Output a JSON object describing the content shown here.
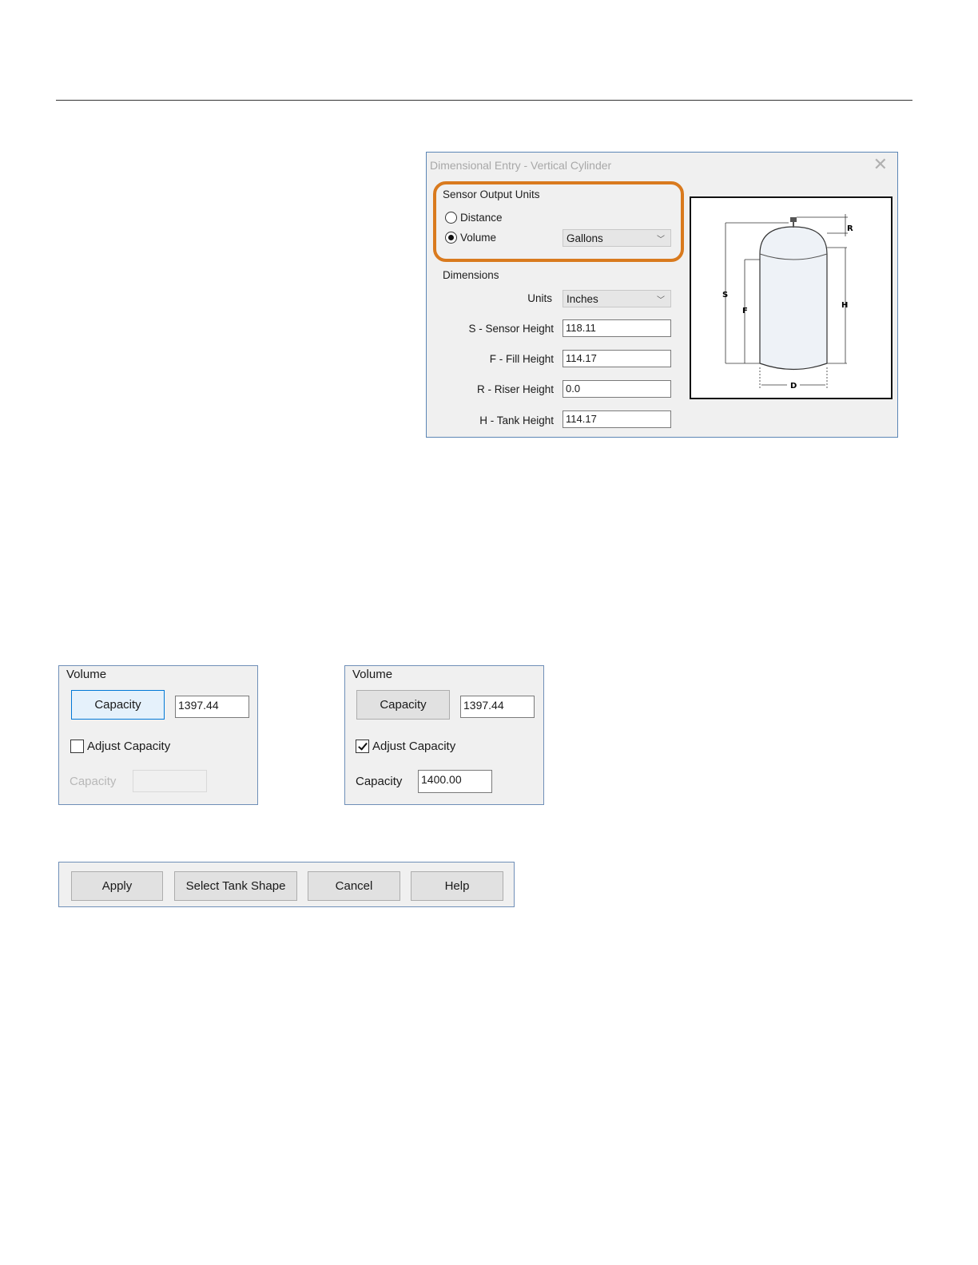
{
  "dialog": {
    "title": "Dimensional Entry - Vertical Cylinder",
    "close": "✕",
    "output_units": {
      "label": "Sensor Output Units",
      "distance_label": "Distance",
      "volume_label": "Volume",
      "selected": "Volume",
      "volume_unit": "Gallons"
    },
    "dimensions": {
      "label": "Dimensions",
      "units_label": "Units",
      "units_value": "Inches",
      "fields": [
        {
          "label": "S - Sensor Height",
          "value": "118.11"
        },
        {
          "label": "F - Fill Height",
          "value": "114.17"
        },
        {
          "label": "R - Riser Height",
          "value": "0.0"
        },
        {
          "label": "H - Tank Height",
          "value": "114.17"
        }
      ]
    },
    "diagram": {
      "s": "S",
      "f": "F",
      "h": "H",
      "r": "R",
      "d": "D"
    }
  },
  "volume_panel_left": {
    "title": "Volume",
    "capacity_button": "Capacity",
    "capacity_value": "1397.44",
    "adjust_label": "Adjust Capacity",
    "adjust_checked": false,
    "capacity_label": "Capacity",
    "capacity_adjusted": ""
  },
  "volume_panel_right": {
    "title": "Volume",
    "capacity_button": "Capacity",
    "capacity_value": "1397.44",
    "adjust_label": "Adjust Capacity",
    "adjust_checked": true,
    "capacity_label": "Capacity",
    "capacity_adjusted": "1400.00"
  },
  "buttons": {
    "apply": "Apply",
    "select_shape": "Select Tank Shape",
    "cancel": "Cancel",
    "help": "Help"
  },
  "colors": {
    "highlight": "#d97a1e",
    "focus": "#0078d7"
  }
}
